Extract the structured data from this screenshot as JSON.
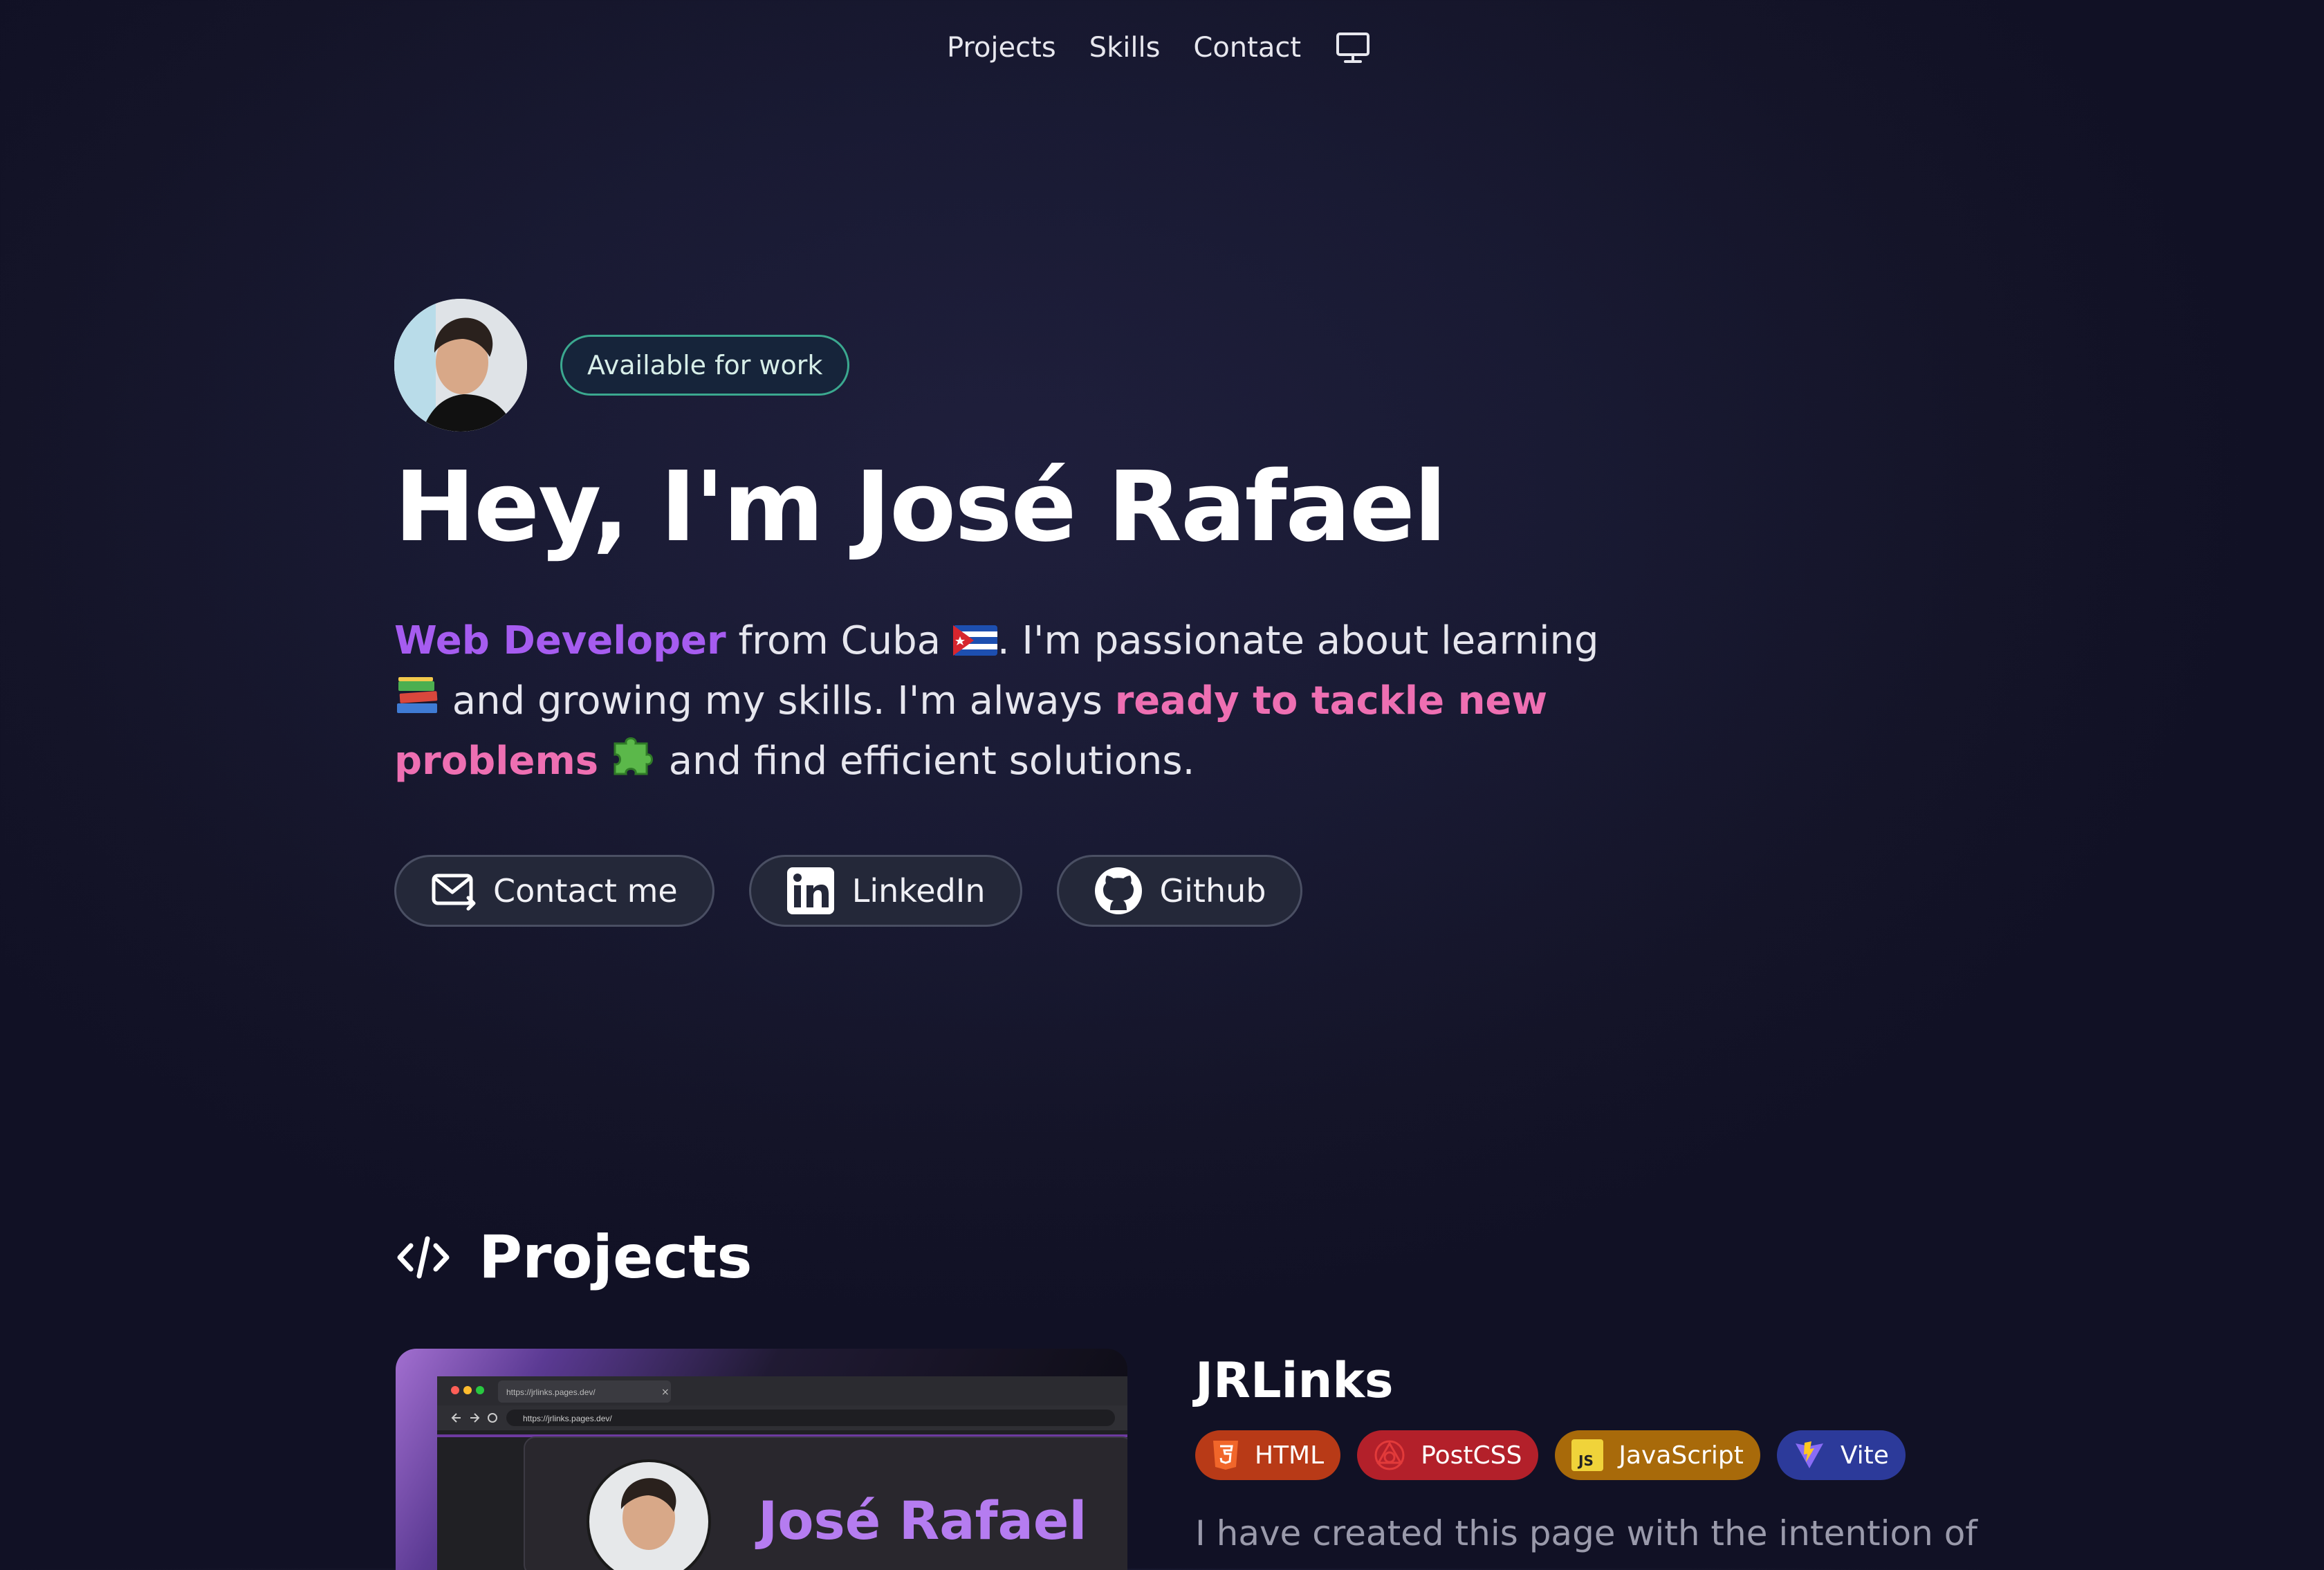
{
  "nav": {
    "items": [
      "Projects",
      "Skills",
      "Contact"
    ],
    "theme_icon": "monitor-icon"
  },
  "hero": {
    "badge": "Available for work",
    "title": "Hey, I'm José Rafael",
    "desc": {
      "role": "Web Developer",
      "t1": " from Cuba ",
      "t2": ". I'm passionate about learning ",
      "t3": " and growing my skills. I'm always ",
      "highlight": "ready to tackle new problems",
      "t4": " and find efficient solutions."
    },
    "buttons": [
      {
        "label": "Contact me",
        "icon": "mail-icon"
      },
      {
        "label": "LinkedIn",
        "icon": "linkedin-icon"
      },
      {
        "label": "Github",
        "icon": "github-icon"
      }
    ]
  },
  "projects": {
    "title": "Projects",
    "icon": "code-icon",
    "item": {
      "name": "JRLinks",
      "tags": [
        {
          "label": "HTML",
          "bg": "#b83a17",
          "icon": "html5-icon"
        },
        {
          "label": "PostCSS",
          "bg": "#b3202a",
          "icon": "postcss-icon"
        },
        {
          "label": "JavaScript",
          "bg": "#a86a0a",
          "icon": "javascript-icon"
        },
        {
          "label": "Vite",
          "bg": "#2c3a9a",
          "icon": "vite-icon"
        }
      ],
      "description": "I have created this page with the intention of",
      "preview": {
        "tab_url": "https://jrlinks.pages.dev/",
        "address": "https://jrlinks.pages.dev/",
        "heading": "José Rafael"
      }
    }
  },
  "colors": {
    "accent_purple": "#a65cf0",
    "accent_pink": "#ee6fb2",
    "badge_border": "#3ba88f"
  }
}
